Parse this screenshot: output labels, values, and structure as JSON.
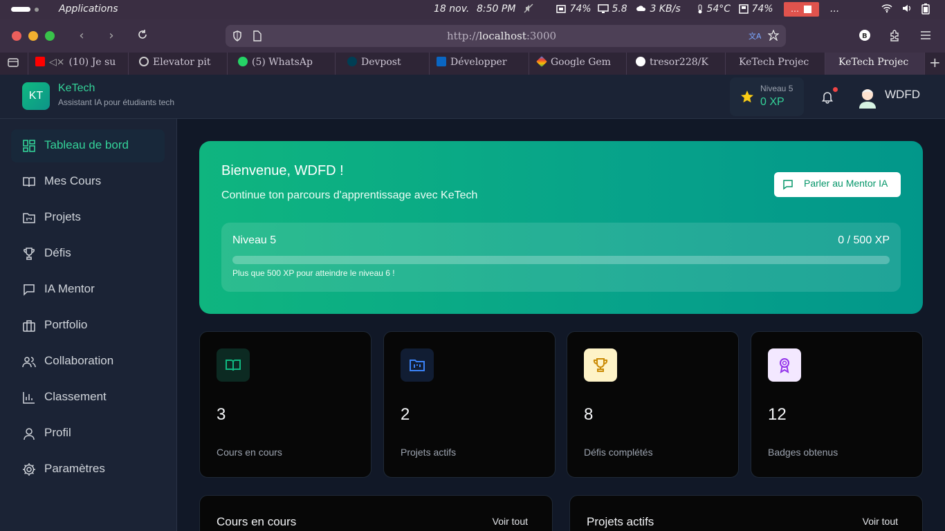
{
  "os": {
    "apps_label": "Applications",
    "date": "18 nov.",
    "time": "8:50 PM",
    "cpu": "74%",
    "display": "5.8",
    "net": "3 KB/s",
    "temp": "54°C",
    "mem": "74%",
    "more": "..."
  },
  "browser": {
    "url_prefix": "http://",
    "url_host": "localhost",
    "url_port": ":3000",
    "tabs": [
      {
        "label": "(10) Je su",
        "color": "#ff0000"
      },
      {
        "label": "Elevator pit",
        "color": "#cfcfcf"
      },
      {
        "label": "(5) WhatsAp",
        "color": "#25d366"
      },
      {
        "label": "Devpost",
        "color": "#003e54"
      },
      {
        "label": "Développer",
        "color": "#0a66c2"
      },
      {
        "label": "Google Gem",
        "color": "#4285f4"
      },
      {
        "label": "tresor228/K",
        "color": "#ffffff"
      },
      {
        "label": "KeTech Projec",
        "color": ""
      },
      {
        "label": "KeTech Projec",
        "color": ""
      }
    ]
  },
  "header": {
    "logo_text": "KT",
    "brand": "KeTech",
    "tagline": "Assistant IA pour étudiants tech",
    "level_label": "Niveau 5",
    "xp_label": "0 XP",
    "username": "WDFD"
  },
  "sidebar": {
    "items": [
      {
        "label": "Tableau de bord",
        "icon": "dashboard-icon"
      },
      {
        "label": "Mes Cours",
        "icon": "book-icon"
      },
      {
        "label": "Projets",
        "icon": "folder-icon"
      },
      {
        "label": "Défis",
        "icon": "trophy-icon"
      },
      {
        "label": "IA Mentor",
        "icon": "chat-icon"
      },
      {
        "label": "Portfolio",
        "icon": "briefcase-icon"
      },
      {
        "label": "Collaboration",
        "icon": "users-icon"
      },
      {
        "label": "Classement",
        "icon": "bar-chart-icon"
      },
      {
        "label": "Profil",
        "icon": "user-icon"
      },
      {
        "label": "Paramètres",
        "icon": "settings-icon"
      }
    ]
  },
  "hero": {
    "title": "Bienvenue, WDFD !",
    "subtitle": "Continue ton parcours d'apprentissage avec KeTech",
    "mentor_button": "Parler au Mentor IA",
    "level": "Niveau 5",
    "xp_progress": "0 / 500 XP",
    "progress_fraction": 0,
    "hint": "Plus que 500 XP pour atteindre le niveau 6 !"
  },
  "stats": [
    {
      "value": "3",
      "label": "Cours en cours",
      "icon": "book-open-icon",
      "color": "#10b981",
      "bg": "#0c2a22"
    },
    {
      "value": "2",
      "label": "Projets actifs",
      "icon": "folder-kanban-icon",
      "color": "#3b82f6",
      "bg": "#111d33"
    },
    {
      "value": "8",
      "label": "Défis complétés",
      "icon": "trophy-icon",
      "color": "#ca8a04",
      "bg": "#fef3c7"
    },
    {
      "value": "12",
      "label": "Badges obtenus",
      "icon": "award-icon",
      "color": "#9333ea",
      "bg": "#f3e8ff"
    }
  ],
  "panels": [
    {
      "title": "Cours en cours",
      "link": "Voir tout"
    },
    {
      "title": "Projets actifs",
      "link": "Voir tout"
    }
  ]
}
